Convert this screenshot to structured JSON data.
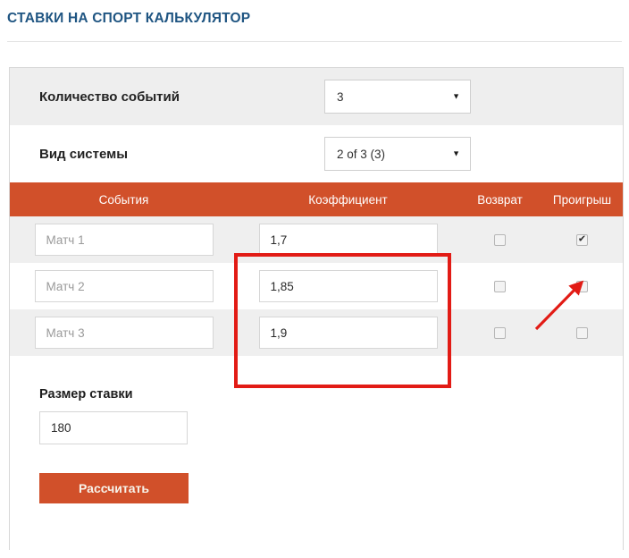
{
  "page": {
    "title": "СТАВКИ НА СПОРТ КАЛЬКУЛЯТОР"
  },
  "options": [
    {
      "label": "Количество событий",
      "value": "3",
      "caret": "▼"
    },
    {
      "label": "Вид системы",
      "value": "2 of 3 (3)",
      "caret": "▼"
    }
  ],
  "table": {
    "headers": {
      "events": "События",
      "coefficient": "Коэффициент",
      "refund": "Возврат",
      "loss": "Проигрыш"
    },
    "rows": [
      {
        "event_placeholder": "Матч 1",
        "event_value": "",
        "coefficient": "1,7",
        "refund_checked": false,
        "loss_checked": true
      },
      {
        "event_placeholder": "Матч 2",
        "event_value": "",
        "coefficient": "1,85",
        "refund_checked": false,
        "loss_checked": false
      },
      {
        "event_placeholder": "Матч 3",
        "event_value": "",
        "coefficient": "1,9",
        "refund_checked": false,
        "loss_checked": false
      }
    ]
  },
  "stake": {
    "label": "Размер ставки",
    "value": "180",
    "button_label": "Рассчитать"
  },
  "colors": {
    "title_blue": "#1f5582",
    "accent_orange": "#d1502a",
    "annotation_red": "#e21b15",
    "row_shaded": "#efefef",
    "option_shaded": "#eeeeee"
  },
  "annotations": {
    "highlight_rect_target": "coefficient-column-inputs",
    "arrow_target": "loss-checkbox-row-1"
  }
}
